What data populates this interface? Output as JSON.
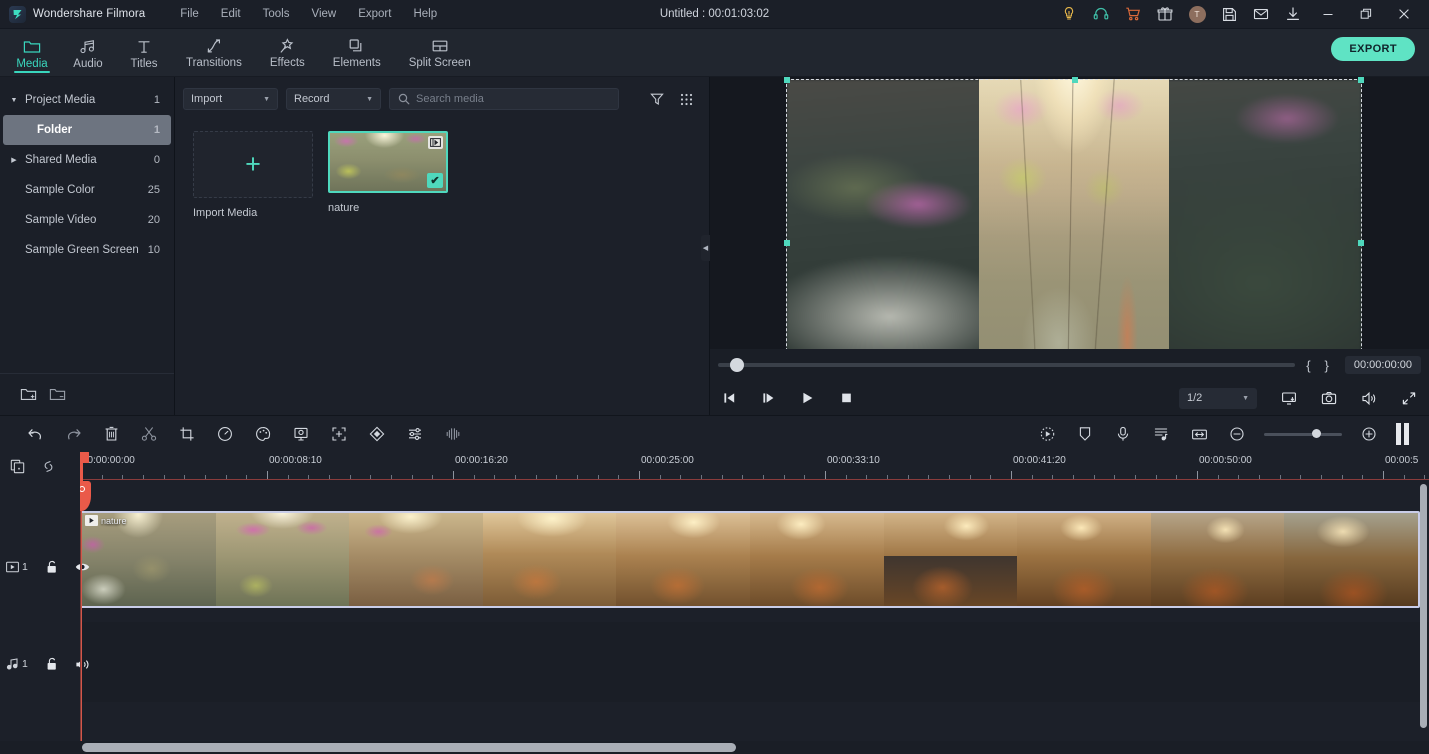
{
  "titlebar": {
    "brand": "Wondershare Filmora",
    "logo_icon": "filmora-logo-icon",
    "menus": [
      "File",
      "Edit",
      "Tools",
      "View",
      "Export",
      "Help"
    ],
    "project_title": "Untitled : 00:01:03:02",
    "right_icons": [
      "lightbulb-idea-icon",
      "headset-support-icon",
      "cart-icon",
      "gift-icon",
      "user-avatar",
      "save-icon",
      "mail-icon",
      "download-icon"
    ],
    "avatar_initial": "T",
    "window_controls": [
      "minimize-button",
      "restore-button",
      "close-button"
    ]
  },
  "tabbar": {
    "tabs": [
      {
        "label": "Media",
        "icon": "folder-icon",
        "active": true
      },
      {
        "label": "Audio",
        "icon": "music-note-icon",
        "active": false
      },
      {
        "label": "Titles",
        "icon": "text-t-icon",
        "active": false
      },
      {
        "label": "Transitions",
        "icon": "transition-arrows-icon",
        "active": false
      },
      {
        "label": "Effects",
        "icon": "magic-wand-icon",
        "active": false
      },
      {
        "label": "Elements",
        "icon": "layers-icon",
        "active": false
      },
      {
        "label": "Split Screen",
        "icon": "split-screen-icon",
        "active": false
      }
    ],
    "export_label": "EXPORT",
    "accent": "#5fe3c4"
  },
  "library": {
    "items": [
      {
        "label": "Project Media",
        "count": "1",
        "arrow": "down",
        "selected": false,
        "indent": false
      },
      {
        "label": "Folder",
        "count": "1",
        "arrow": "none",
        "selected": true,
        "indent": true
      },
      {
        "label": "Shared Media",
        "count": "0",
        "arrow": "right",
        "selected": false,
        "indent": false
      },
      {
        "label": "Sample Color",
        "count": "25",
        "arrow": "none",
        "selected": false,
        "indent": false
      },
      {
        "label": "Sample Video",
        "count": "20",
        "arrow": "none",
        "selected": false,
        "indent": false
      },
      {
        "label": "Sample Green Screen",
        "count": "10",
        "arrow": "none",
        "selected": false,
        "indent": false
      }
    ],
    "footer_icons": [
      "new-folder-icon",
      "remove-folder-icon"
    ]
  },
  "browser": {
    "import_dropdown": "Import",
    "record_dropdown": "Record",
    "search_placeholder": "Search media",
    "search_value": "",
    "filter_icon": "filter-funnel-icon",
    "view_icon": "grid-view-icon",
    "import_tile_label": "Import Media",
    "media": [
      {
        "name": "nature",
        "selected": true,
        "type_badge": "film-strip-icon",
        "check_badge": "checkmark-icon"
      }
    ],
    "collapse_icon": "collapse-left-icon"
  },
  "preview": {
    "current_time": "00:00:00:00",
    "mark_in_label": "{",
    "mark_out_label": "}",
    "controls": [
      {
        "name": "previous-frame-button",
        "icon": "step-backward-icon"
      },
      {
        "name": "next-frame-button",
        "icon": "step-forward-icon"
      },
      {
        "name": "play-button",
        "icon": "play-icon"
      },
      {
        "name": "stop-button",
        "icon": "stop-icon"
      }
    ],
    "quality_value": "1/2",
    "right_controls": [
      "display-settings-icon",
      "snapshot-camera-icon",
      "volume-icon",
      "fullscreen-icon"
    ],
    "progress_percent": 2
  },
  "timeline": {
    "left_tools": [
      "undo-icon",
      "redo-icon",
      "delete-icon",
      "split-scissors-icon",
      "crop-icon",
      "speed-icon",
      "color-palette-icon",
      "green-screen-icon",
      "crop-fit-icon",
      "keyframe-icon",
      "adjust-sliders-icon",
      "audio-detach-icon"
    ],
    "right_tools": [
      "render-preview-icon",
      "marker-icon",
      "voiceover-mic-icon",
      "auto-captions-icon",
      "fit-timeline-icon"
    ],
    "zoom_out_icon": "zoom-out-icon",
    "zoom_in_icon": "zoom-in-icon",
    "zoom_value": 62,
    "snap_icons": [
      "duplicate-icon",
      "link-icon"
    ],
    "ruler_labels": [
      "00:00:00:00",
      "00:00:08:10",
      "00:00:16:20",
      "00:00:25:00",
      "00:00:33:10",
      "00:00:41:20",
      "00:00:50:00",
      "00:00:5"
    ],
    "playhead_time": "00:00:00:00",
    "tracks": [
      {
        "name": "video-track-1",
        "label": "1",
        "type_icon": "video-track-icon",
        "lock_icon": "unlock-icon",
        "visibility_icon": "eye-icon"
      },
      {
        "name": "audio-track-1",
        "label": "1",
        "type_icon": "audio-track-icon",
        "lock_icon": "unlock-icon",
        "visibility_icon": "speaker-icon"
      }
    ],
    "clip": {
      "name": "nature",
      "play_icon": "play-small-icon"
    }
  }
}
